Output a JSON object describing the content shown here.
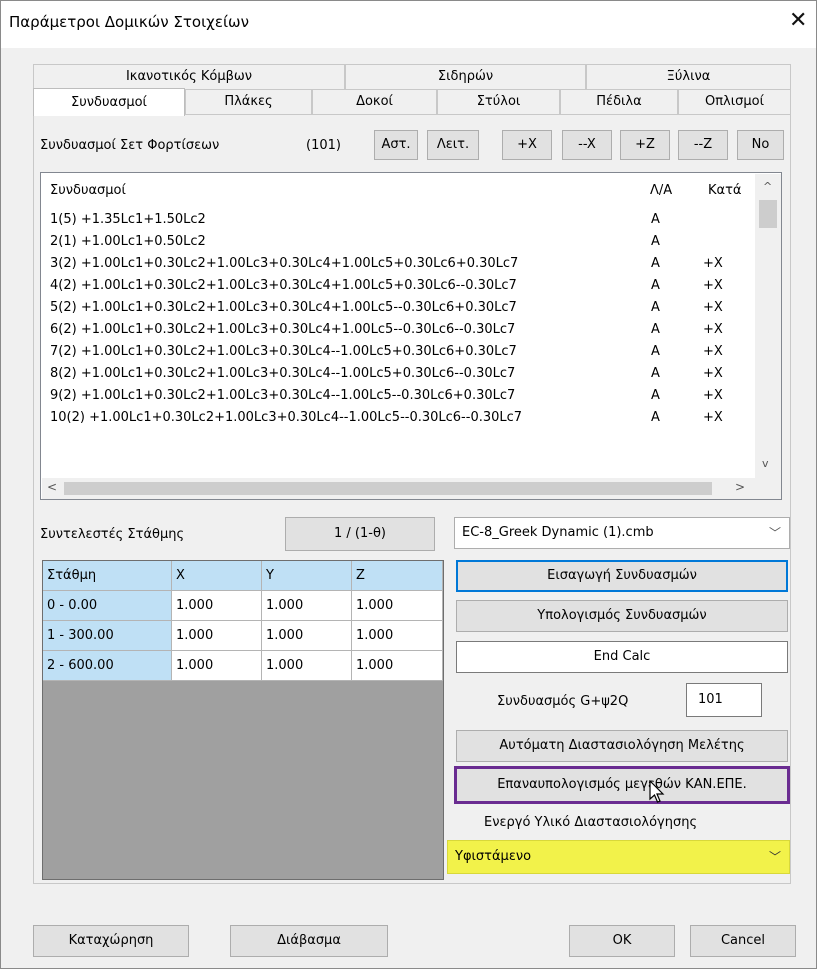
{
  "window": {
    "title": "Παράμετροι Δομικών Στοιχείων",
    "close": "✕"
  },
  "tabs_top": [
    "Ικανοτικός Κόμβων",
    "Σιδηρών",
    "Ξύλινα"
  ],
  "tabs_bottom": [
    "Συνδυασμοί",
    "Πλάκες",
    "Δοκοί",
    "Στύλοι",
    "Πέδιλα",
    "Οπλισμοί"
  ],
  "combos_toolbar": {
    "label": "Συνδυασμοί Σετ Φορτίσεων",
    "count": "(101)",
    "buttons": [
      "Αστ.",
      "Λειτ.",
      "+X",
      "--X",
      "+Z",
      "--Z",
      "No"
    ]
  },
  "combinations": {
    "headers": [
      "Συνδυασμοί",
      "Λ/Α",
      "Κατά"
    ],
    "rows": [
      [
        "1(5) +1.35Lc1+1.50Lc2",
        "A",
        ""
      ],
      [
        "2(1) +1.00Lc1+0.50Lc2",
        "A",
        ""
      ],
      [
        "3(2) +1.00Lc1+0.30Lc2+1.00Lc3+0.30Lc4+1.00Lc5+0.30Lc6+0.30Lc7",
        "A",
        "+X"
      ],
      [
        "4(2) +1.00Lc1+0.30Lc2+1.00Lc3+0.30Lc4+1.00Lc5+0.30Lc6--0.30Lc7",
        "A",
        "+X"
      ],
      [
        "5(2) +1.00Lc1+0.30Lc2+1.00Lc3+0.30Lc4+1.00Lc5--0.30Lc6+0.30Lc7",
        "A",
        "+X"
      ],
      [
        "6(2) +1.00Lc1+0.30Lc2+1.00Lc3+0.30Lc4+1.00Lc5--0.30Lc6--0.30Lc7",
        "A",
        "+X"
      ],
      [
        "7(2) +1.00Lc1+0.30Lc2+1.00Lc3+0.30Lc4--1.00Lc5+0.30Lc6+0.30Lc7",
        "A",
        "+X"
      ],
      [
        "8(2) +1.00Lc1+0.30Lc2+1.00Lc3+0.30Lc4--1.00Lc5+0.30Lc6--0.30Lc7",
        "A",
        "+X"
      ],
      [
        "9(2) +1.00Lc1+0.30Lc2+1.00Lc3+0.30Lc4--1.00Lc5--0.30Lc6+0.30Lc7",
        "A",
        "+X"
      ],
      [
        "10(2) +1.00Lc1+0.30Lc2+1.00Lc3+0.30Lc4--1.00Lc5--0.30Lc6--0.30Lc7",
        "A",
        "+X"
      ]
    ]
  },
  "level_factors": {
    "label": "Συντελεστές Στάθμης",
    "button": "1 / (1-θ)"
  },
  "levels_table": {
    "headers": [
      "Στάθμη",
      "X",
      "Y",
      "Z"
    ],
    "rows": [
      [
        "0 - 0.00",
        "1.000",
        "1.000",
        "1.000"
      ],
      [
        "1 - 300.00",
        "1.000",
        "1.000",
        "1.000"
      ],
      [
        "2 - 600.00",
        "1.000",
        "1.000",
        "1.000"
      ]
    ]
  },
  "right_panel": {
    "file_select": "EC-8_Greek Dynamic (1).cmb",
    "import_button": "Εισαγωγή Συνδυασμών",
    "compute_button": "Υπολογισμός Συνδυασμών",
    "end_calc": "End Calc",
    "g_label": "Συνδυασμός G+ψ2Q",
    "g_value": "101",
    "auto_design_button": "Αυτόματη Διαστασιολόγηση Μελέτης",
    "recalc_button": "Επαναυπολογισμός μεγεθών ΚΑΝ.ΕΠΕ.",
    "material_label": "Ενεργό Υλικό Διαστασιολόγησης",
    "material_select": "Υφιστάμενο"
  },
  "footer": {
    "save": "Καταχώρηση",
    "read": "Διάβασμα",
    "ok": "OK",
    "cancel": "Cancel"
  },
  "colors": {
    "highlight_purple": "#6a2c91",
    "highlight_yellow": "#f2f24a",
    "focus_blue": "#0078d7",
    "table_header_blue": "#bfe0f5"
  }
}
